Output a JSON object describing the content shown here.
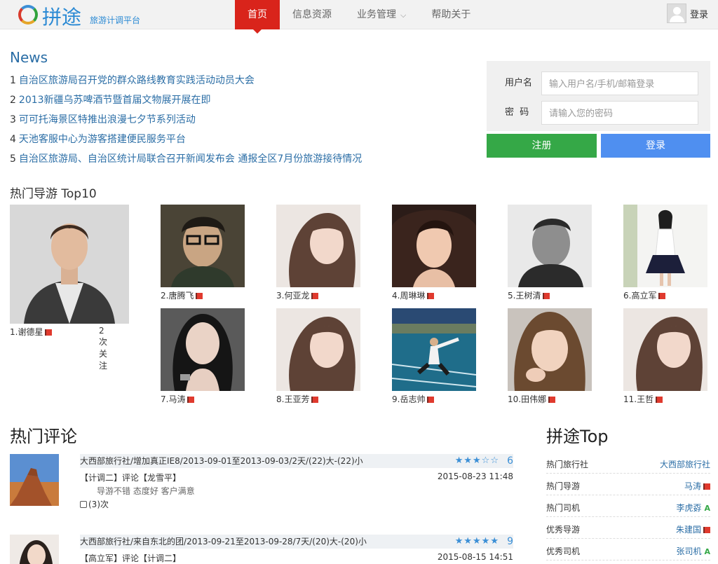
{
  "header": {
    "logo_text": "拼途",
    "logo_sub": "旅游计调平台",
    "nav": [
      {
        "label": "首页",
        "active": true
      },
      {
        "label": "信息资源",
        "active": false
      },
      {
        "label": "业务管理",
        "active": false,
        "dropdown": true
      },
      {
        "label": "帮助关于",
        "active": false
      }
    ],
    "login_label": "登录"
  },
  "news": {
    "title": "News",
    "items": [
      {
        "num": "1",
        "text": "自治区旅游局召开党的群众路线教育实践活动动员大会"
      },
      {
        "num": "2",
        "text": "2013新疆乌苏啤酒节暨首届文物展开展在即"
      },
      {
        "num": "3",
        "text": "可可托海景区特推出浪漫七夕节系列活动"
      },
      {
        "num": "4",
        "text": "天池客服中心为游客搭建便民服务平台"
      },
      {
        "num": "5",
        "text": "自治区旅游局、自治区统计局联合召开新闻发布会 通报全区7月份旅游接待情况"
      }
    ]
  },
  "login": {
    "username_label": "用户名",
    "username_placeholder": "输入用户名/手机/邮箱登录",
    "password_label": "密  码",
    "password_placeholder": "请输入您的密码",
    "register_button": "注册",
    "login_button": "登录"
  },
  "top_guides": {
    "title": "热门导游 Top10",
    "featured": {
      "caption": "1.谢德星",
      "follows": "2次关注"
    },
    "guides": [
      {
        "caption": "2.唐腾飞"
      },
      {
        "caption": "3.何亚龙"
      },
      {
        "caption": "4.周琳琳"
      },
      {
        "caption": "5.王树清"
      },
      {
        "caption": "6.高立军"
      },
      {
        "caption": "7.马涛"
      },
      {
        "caption": "8.王亚芳"
      },
      {
        "caption": "9.岳志帅"
      },
      {
        "caption": "10.田伟娜"
      },
      {
        "caption": "11.王哲"
      }
    ]
  },
  "comments": {
    "title": "热门评论",
    "items": [
      {
        "route": "大西部旅行社/增加真正IE8/2013-09-01至2013-09-03/2天/(22)大-(22)小",
        "stars": "★★★☆☆",
        "score": "6",
        "byline": "【计调二】评论【龙雪平】",
        "date": "2015-08-23 11:48",
        "tags": "导游不错 态度好 客户满意",
        "likes": "(3)次"
      },
      {
        "route": "大西部旅行社/来自东北的团/2013-09-21至2013-09-28/7天/(20)大-(20)小",
        "stars": "★★★★★",
        "score": "9",
        "byline": "【高立军】评论【计调二】",
        "date": "2015-08-15 14:51"
      }
    ]
  },
  "pintu_top": {
    "title": "拼途Top",
    "rows": [
      {
        "label": "热门旅行社",
        "value": "大西部旅行社",
        "mark": ""
      },
      {
        "label": "热门导游",
        "value": "马涛",
        "mark": "flag"
      },
      {
        "label": "热门司机",
        "value": "李虎孬",
        "mark": "driver"
      },
      {
        "label": "优秀导游",
        "value": "朱建国",
        "mark": "flag"
      },
      {
        "label": "优秀司机",
        "value": "张司机",
        "mark": "driver"
      }
    ]
  },
  "colors": {
    "accent_red": "#d9241b",
    "link_blue": "#2b6ea6",
    "register_green": "#35a847",
    "login_blue": "#4f8ff0"
  }
}
